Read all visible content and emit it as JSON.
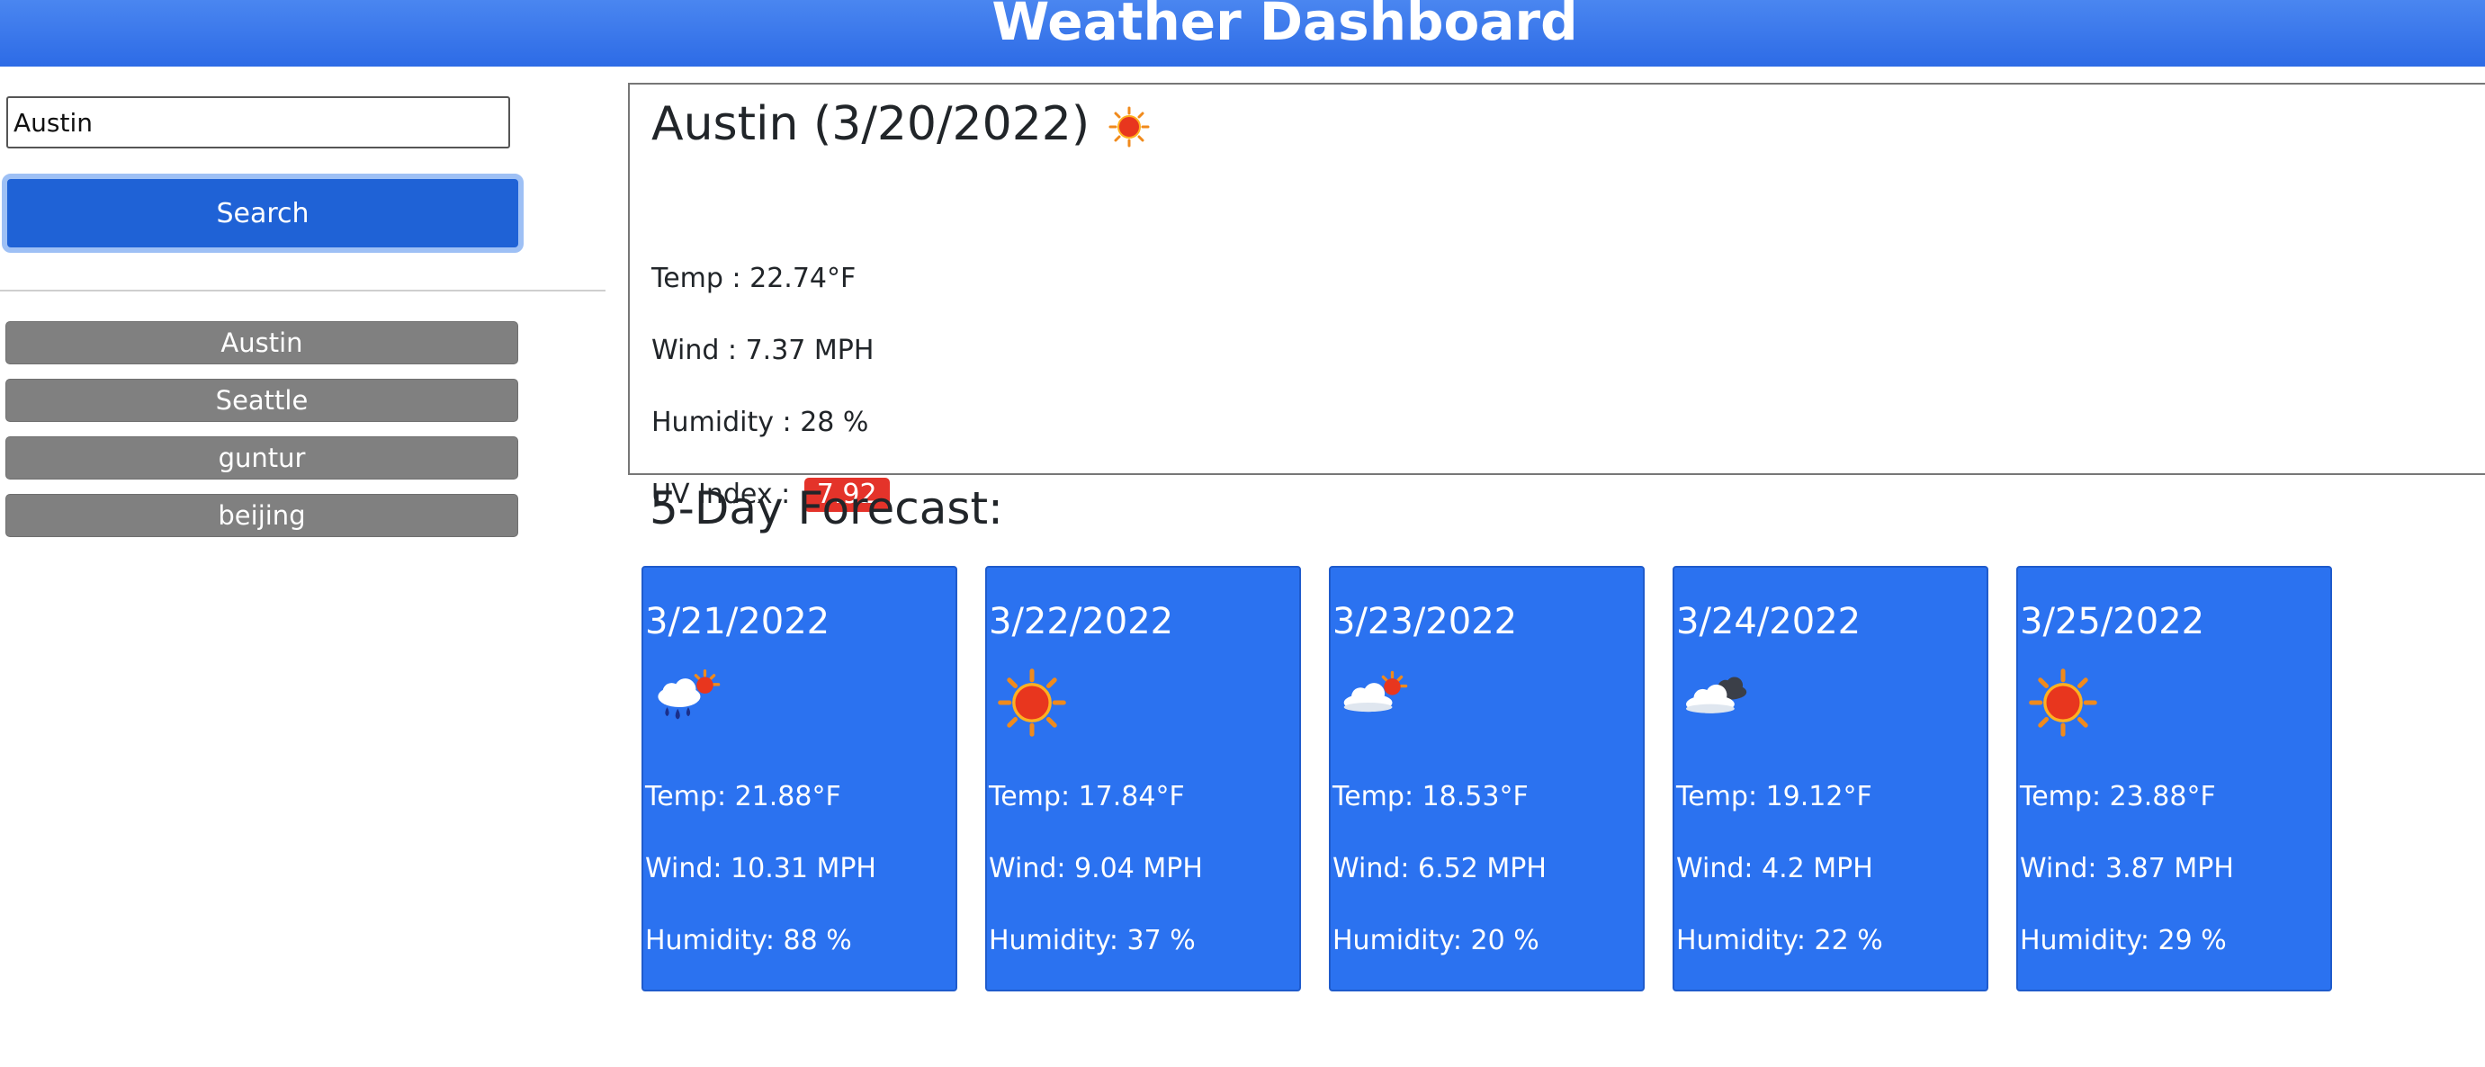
{
  "header": {
    "title": "Weather Dashboard"
  },
  "search": {
    "value": "Austin",
    "button_label": "Search"
  },
  "history": [
    "Austin",
    "Seattle",
    "guntur",
    "beijing"
  ],
  "current": {
    "title": "Austin (3/20/2022)",
    "icon": "sun-icon",
    "temp": "Temp : 22.74°F",
    "wind": "Wind : 7.37 MPH",
    "humidity": "Humidity : 28 %",
    "uv_label": "UV Index :",
    "uv_value": "7.92",
    "uv_color": "#e4332a"
  },
  "forecast": {
    "heading": "5-Day Forecast:",
    "days": [
      {
        "date": "3/21/2022",
        "icon": "rain-sun-icon",
        "temp": "Temp: 21.88°F",
        "wind": "Wind: 10.31 MPH",
        "humidity": "Humidity: 88 %"
      },
      {
        "date": "3/22/2022",
        "icon": "sun-icon",
        "temp": "Temp: 17.84°F",
        "wind": "Wind: 9.04 MPH",
        "humidity": "Humidity: 37 %"
      },
      {
        "date": "3/23/2022",
        "icon": "cloud-sun-icon",
        "temp": "Temp: 18.53°F",
        "wind": "Wind: 6.52 MPH",
        "humidity": "Humidity: 20 %"
      },
      {
        "date": "3/24/2022",
        "icon": "cloudy-icon",
        "temp": "Temp: 19.12°F",
        "wind": "Wind: 4.2 MPH",
        "humidity": "Humidity: 22 %"
      },
      {
        "date": "3/25/2022",
        "icon": "sun-icon",
        "temp": "Temp: 23.88°F",
        "wind": "Wind: 3.87 MPH",
        "humidity": "Humidity: 29 %"
      }
    ]
  },
  "colors": {
    "header": "#2d6be6",
    "search_button": "#1f62d6",
    "forecast_card": "#2b72f0",
    "history_button": "#808080"
  }
}
